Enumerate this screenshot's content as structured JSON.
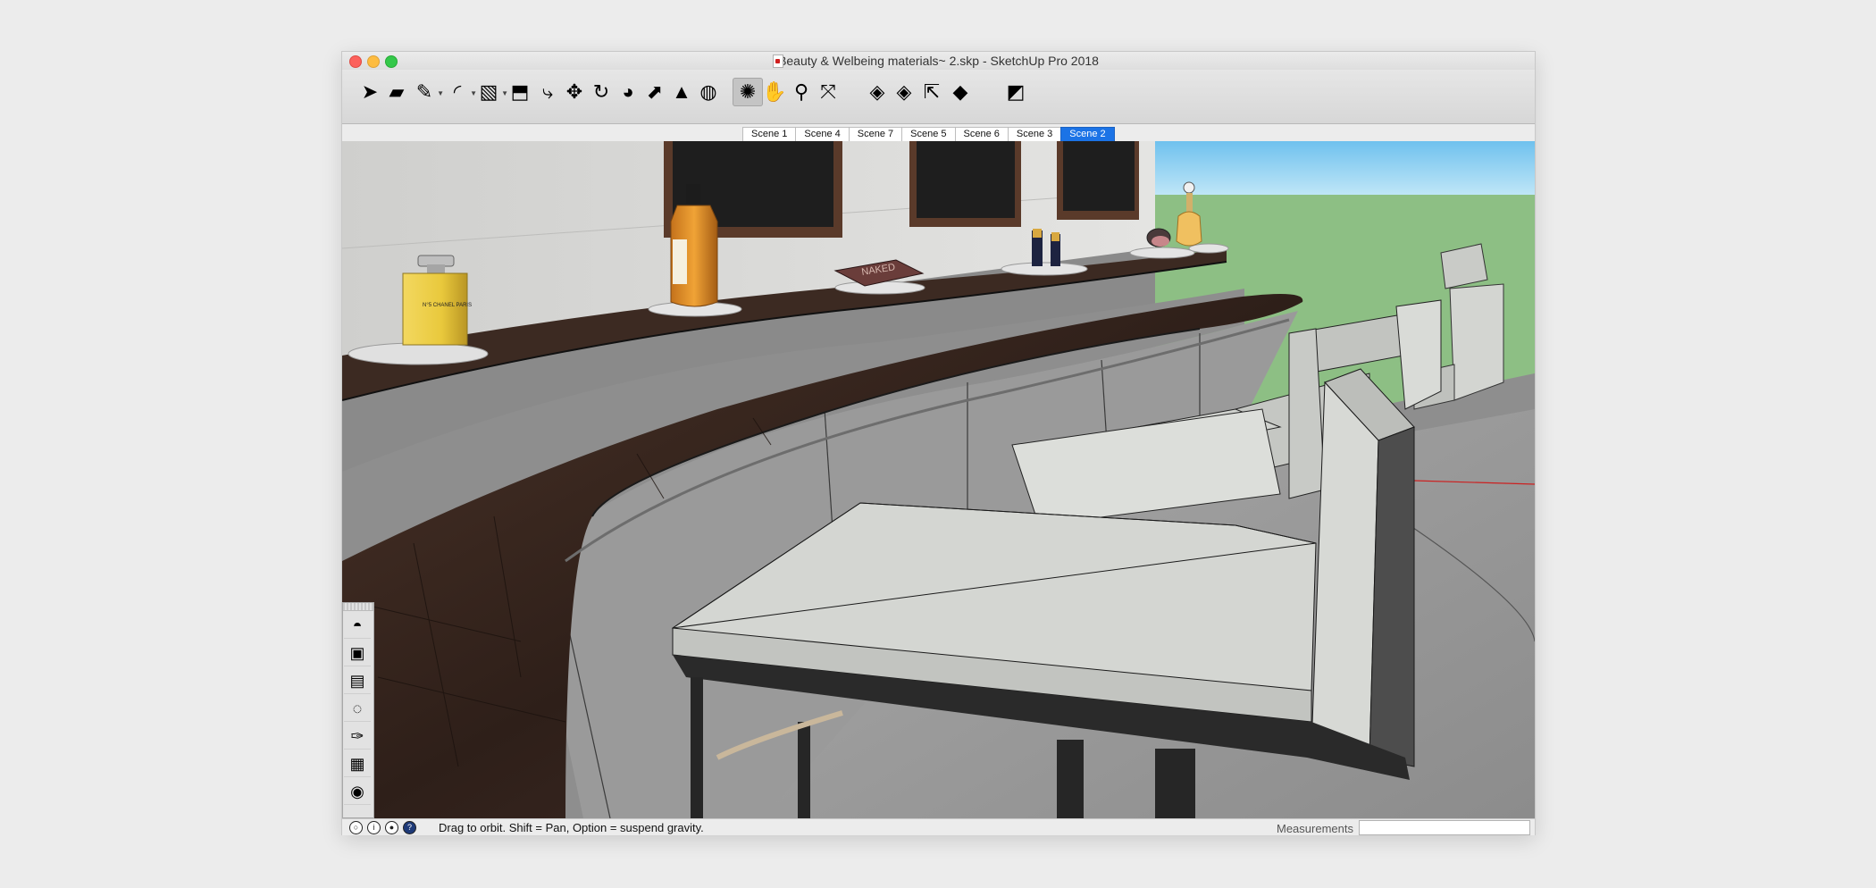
{
  "window": {
    "title": "Beauty & Welbeing materials~ 2.skp - SketchUp Pro 2018"
  },
  "toolbar": {
    "tools": [
      {
        "name": "select-tool",
        "icon": "arrow-cursor-icon",
        "glyph": "➤"
      },
      {
        "name": "eraser-tool",
        "icon": "eraser-icon",
        "glyph": "▰"
      },
      {
        "name": "line-tool",
        "icon": "pencil-icon",
        "glyph": "✎",
        "has_dropdown": true
      },
      {
        "name": "arc-tool",
        "icon": "arc-icon",
        "glyph": "◜",
        "has_dropdown": true
      },
      {
        "name": "rectangle-tool",
        "icon": "rectangle-icon",
        "glyph": "▧",
        "has_dropdown": true
      },
      {
        "name": "push-pull-tool",
        "icon": "push-pull-icon",
        "glyph": "⬒"
      },
      {
        "name": "offset-tool",
        "icon": "offset-icon",
        "glyph": "⤷"
      },
      {
        "name": "move-tool",
        "icon": "move-icon",
        "glyph": "✥"
      },
      {
        "name": "rotate-tool",
        "icon": "rotate-icon",
        "glyph": "↻"
      },
      {
        "name": "follow-me-tool",
        "icon": "follow-me-icon",
        "glyph": "◕"
      },
      {
        "name": "scale-tool",
        "icon": "scale-icon",
        "glyph": "⬈"
      },
      {
        "name": "tape-measure-tool",
        "icon": "tape-measure-icon",
        "glyph": "▲"
      },
      {
        "name": "paint-bucket-tool",
        "icon": "paint-bucket-icon",
        "glyph": "◍"
      },
      {
        "name": "orbit-tool",
        "icon": "orbit-icon",
        "glyph": "✺",
        "active": true
      },
      {
        "name": "pan-tool",
        "icon": "hand-icon",
        "glyph": "✋"
      },
      {
        "name": "zoom-tool",
        "icon": "magnifier-icon",
        "glyph": "⚲"
      },
      {
        "name": "zoom-extents-tool",
        "icon": "zoom-extents-icon",
        "glyph": "⤧"
      },
      {
        "name": "3d-warehouse-button",
        "icon": "3d-warehouse-icon",
        "glyph": "◈"
      },
      {
        "name": "extension-warehouse-button",
        "icon": "extension-warehouse-icon",
        "glyph": "◈"
      },
      {
        "name": "share-model-button",
        "icon": "share-model-icon",
        "glyph": "⇱"
      },
      {
        "name": "extension-manager-button",
        "icon": "ruby-gem-icon",
        "glyph": "◆"
      },
      {
        "name": "layout-send-button",
        "icon": "layout-icon",
        "glyph": "◩"
      }
    ]
  },
  "scenes": {
    "tabs": [
      "Scene 1",
      "Scene 4",
      "Scene 7",
      "Scene 5",
      "Scene 6",
      "Scene 3",
      "Scene 2"
    ],
    "active": "Scene 2"
  },
  "palette": {
    "items": [
      {
        "name": "styles-panel-button",
        "icon": "styles-sphere-icon",
        "glyph": "◓"
      },
      {
        "name": "shadows-panel-button",
        "icon": "shadows-icon",
        "glyph": "▣"
      },
      {
        "name": "materials-panel-button",
        "icon": "materials-icon",
        "glyph": "▤"
      },
      {
        "name": "components-panel-button",
        "icon": "components-icon",
        "glyph": "◌"
      },
      {
        "name": "tools-panel-button",
        "icon": "wrench-icon",
        "glyph": "✑"
      },
      {
        "name": "scenes-panel-button",
        "icon": "scenes-box-icon",
        "glyph": "▦"
      },
      {
        "name": "instructor-panel-button",
        "icon": "lightbulb-icon",
        "glyph": "◉"
      }
    ]
  },
  "status": {
    "text": "Drag to orbit. Shift = Pan, Option = suspend gravity.",
    "icons": [
      "geo-location-icon",
      "credits-icon",
      "user-icon",
      "help-icon"
    ]
  },
  "measurements": {
    "label": "Measurements",
    "value": ""
  },
  "colors": {
    "accent": "#1b73e6",
    "sky": "#8fd0f0",
    "grass": "#8bbf82",
    "counter_wood": "#3a2a22",
    "panel_grey": "#8f8f8f",
    "chair_white": "#d6d8d4"
  },
  "model_labels": {
    "perfume_bottle_label": "N°5 CHANEL PARIS",
    "palette_box_label": "NAKED"
  }
}
